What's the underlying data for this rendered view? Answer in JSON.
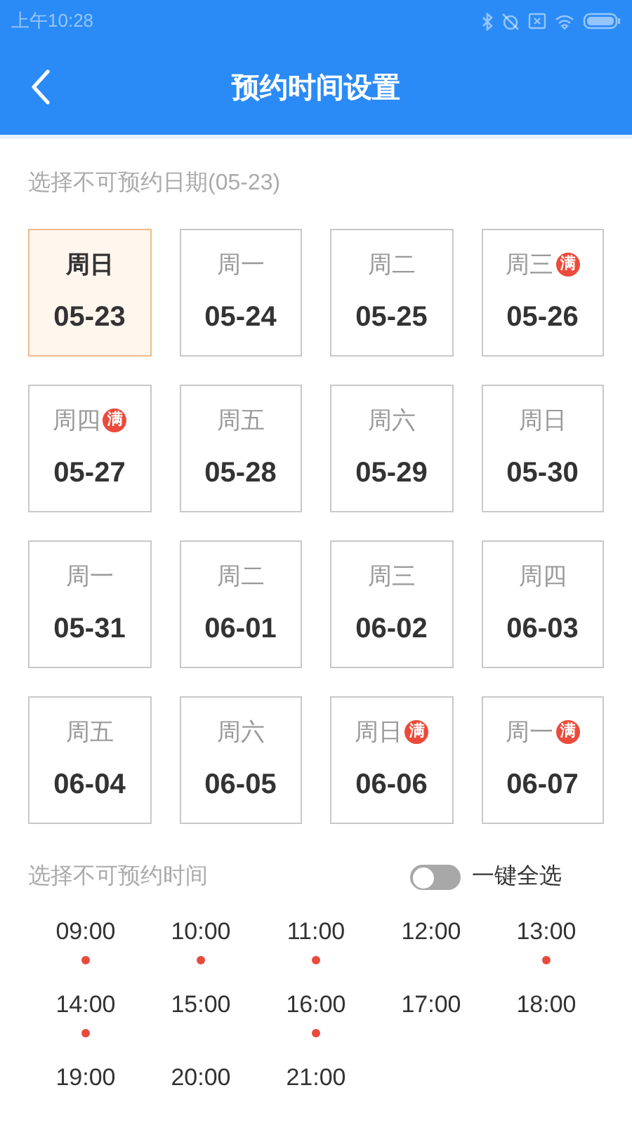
{
  "status_bar": {
    "time": "上午10:28"
  },
  "header": {
    "title": "预约时间设置"
  },
  "date_section": {
    "label": "选择不可预约日期(05-23)"
  },
  "days": [
    {
      "weekday": "周日",
      "date": "05-23",
      "selected": true,
      "full": false
    },
    {
      "weekday": "周一",
      "date": "05-24",
      "selected": false,
      "full": false
    },
    {
      "weekday": "周二",
      "date": "05-25",
      "selected": false,
      "full": false
    },
    {
      "weekday": "周三",
      "date": "05-26",
      "selected": false,
      "full": true,
      "badge": "满"
    },
    {
      "weekday": "周四",
      "date": "05-27",
      "selected": false,
      "full": true,
      "badge": "满"
    },
    {
      "weekday": "周五",
      "date": "05-28",
      "selected": false,
      "full": false
    },
    {
      "weekday": "周六",
      "date": "05-29",
      "selected": false,
      "full": false
    },
    {
      "weekday": "周日",
      "date": "05-30",
      "selected": false,
      "full": false
    },
    {
      "weekday": "周一",
      "date": "05-31",
      "selected": false,
      "full": false
    },
    {
      "weekday": "周二",
      "date": "06-01",
      "selected": false,
      "full": false
    },
    {
      "weekday": "周三",
      "date": "06-02",
      "selected": false,
      "full": false
    },
    {
      "weekday": "周四",
      "date": "06-03",
      "selected": false,
      "full": false
    },
    {
      "weekday": "周五",
      "date": "06-04",
      "selected": false,
      "full": false
    },
    {
      "weekday": "周六",
      "date": "06-05",
      "selected": false,
      "full": false
    },
    {
      "weekday": "周日",
      "date": "06-06",
      "selected": false,
      "full": true,
      "badge": "满"
    },
    {
      "weekday": "周一",
      "date": "06-07",
      "selected": false,
      "full": true,
      "badge": "满"
    }
  ],
  "time_section": {
    "label": "选择不可预约时间",
    "select_all": {
      "label": "一键全选",
      "on": false
    }
  },
  "times": [
    {
      "time": "09:00",
      "marked": true
    },
    {
      "time": "10:00",
      "marked": true
    },
    {
      "time": "11:00",
      "marked": true
    },
    {
      "time": "12:00",
      "marked": false
    },
    {
      "time": "13:00",
      "marked": true
    },
    {
      "time": "14:00",
      "marked": true
    },
    {
      "time": "15:00",
      "marked": false
    },
    {
      "time": "16:00",
      "marked": true
    },
    {
      "time": "17:00",
      "marked": false
    },
    {
      "time": "18:00",
      "marked": false
    },
    {
      "time": "19:00",
      "marked": false
    },
    {
      "time": "20:00",
      "marked": false
    },
    {
      "time": "21:00",
      "marked": false
    }
  ]
}
